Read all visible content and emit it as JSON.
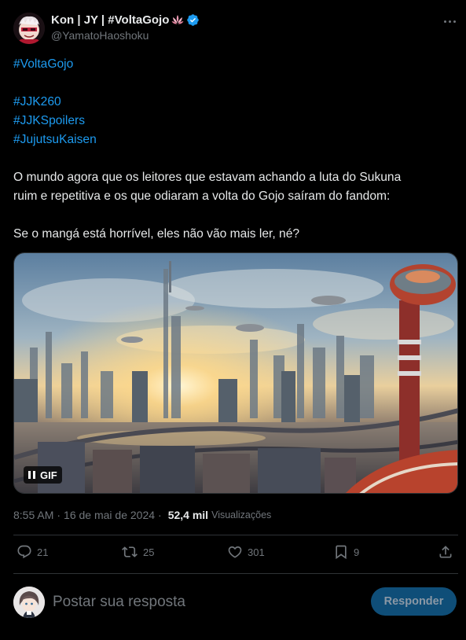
{
  "author": {
    "display_name": "Kon | JY | #VoltaGojo",
    "handle": "@YamatoHaoshoku",
    "verified": true,
    "name_emoji_icon": "lotus-icon",
    "verified_color": "#1d9bf0"
  },
  "tweet": {
    "hashtags_top": [
      "#VoltaGojo"
    ],
    "hashtags_group": [
      "#JJK260",
      "#JJKSpoilers",
      "#JujutsuKaisen"
    ],
    "paragraph_1_line_1": "O mundo agora que os leitores que estavam achando a luta do Sukuna",
    "paragraph_1_line_2": "ruim e repetitiva e os que odiaram a volta do Gojo saíram do fandom:",
    "paragraph_2": "Se o mangá está horrível, eles não vão mais ler, né?",
    "hashtag_color": "#1d9bf0"
  },
  "media": {
    "badge_label": "GIF",
    "badge_icon": "pause-icon"
  },
  "meta": {
    "time": "8:55 AM",
    "separator_1": "·",
    "date": "16 de mai de 2024",
    "separator_2": "·",
    "views_count": "52,4 mil",
    "views_label": "Visualizações"
  },
  "actions": {
    "replies": "21",
    "reposts": "25",
    "likes": "301",
    "bookmarks": "9"
  },
  "reply": {
    "placeholder": "Postar sua resposta",
    "button_label": "Responder",
    "button_color": "#0f4e78"
  }
}
